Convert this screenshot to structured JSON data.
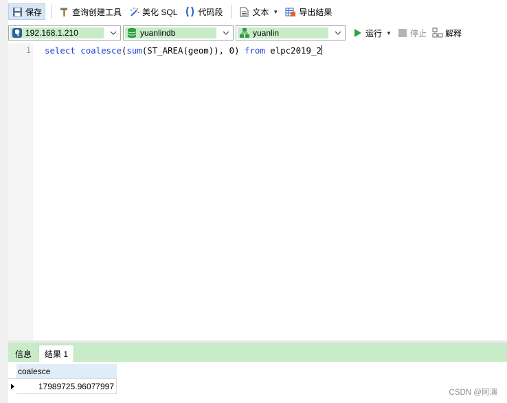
{
  "toolbar": {
    "save": "保存",
    "query_builder": "查询创建工具",
    "beautify_sql": "美化 SQL",
    "code_snippet": "代码段",
    "text": "文本",
    "export_result": "导出结果"
  },
  "connection": {
    "host": "192.168.1.210",
    "database": "yuanlindb",
    "schema": "yuanlin",
    "run": "运行",
    "stop": "停止",
    "explain": "解释"
  },
  "editor": {
    "line_number": "1",
    "tokens": {
      "kw_select": "select",
      "fn_coalesce": "coalesce",
      "p1": "(",
      "fn_sum": "sum",
      "p2": "(ST_AREA(geom)), ",
      "num_zero": "0",
      "p3": ") ",
      "kw_from": "from",
      "p4": " elpc2019_2"
    }
  },
  "result": {
    "tabs": [
      "信息",
      "结果 1"
    ],
    "active_tab": 1,
    "columns": [
      "coalesce"
    ],
    "rows": [
      [
        "17989725.96077997"
      ]
    ]
  },
  "watermark": "CSDN @阿演",
  "colors": {
    "selector_fill": "#c8ecc8",
    "result_tabbar": "#c8ecc8",
    "keyword": "#1a3fd6",
    "header_cell": "#e0edf8"
  }
}
